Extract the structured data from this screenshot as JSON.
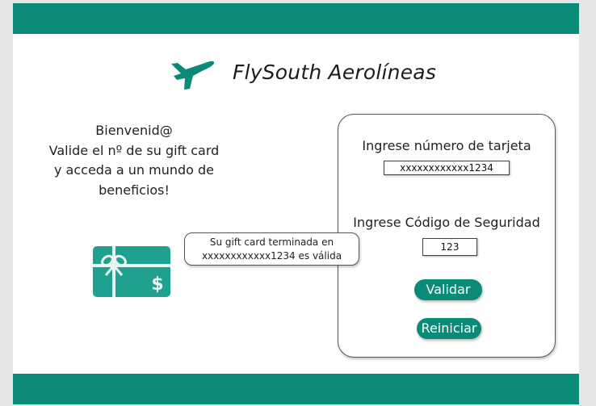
{
  "brand": {
    "title": "FlySouth Aerolíneas",
    "icon": "airplane-icon",
    "color": "#0b8a77"
  },
  "welcome": {
    "lines": [
      "Bienvenid@",
      "Valide el nº de su gift card",
      "y acceda a un mundo de",
      "beneficios!"
    ]
  },
  "gift_card": {
    "icon": "gift-card-icon",
    "symbol": "$",
    "color": "#20a08f"
  },
  "form": {
    "card_number_label": "Ingrese número de tarjeta",
    "card_number_value": "xxxxxxxxxxxx1234",
    "security_code_label": "Ingrese Código de Seguridad",
    "security_code_value": "123",
    "validate_label": "Validar",
    "reset_label": "Reiniciar"
  },
  "toast": {
    "lines": [
      "Su gift card terminada en",
      "xxxxxxxxxxxx1234 es válida"
    ]
  },
  "colors": {
    "accent": "#0b8a77",
    "background": "#e6e6e6"
  }
}
